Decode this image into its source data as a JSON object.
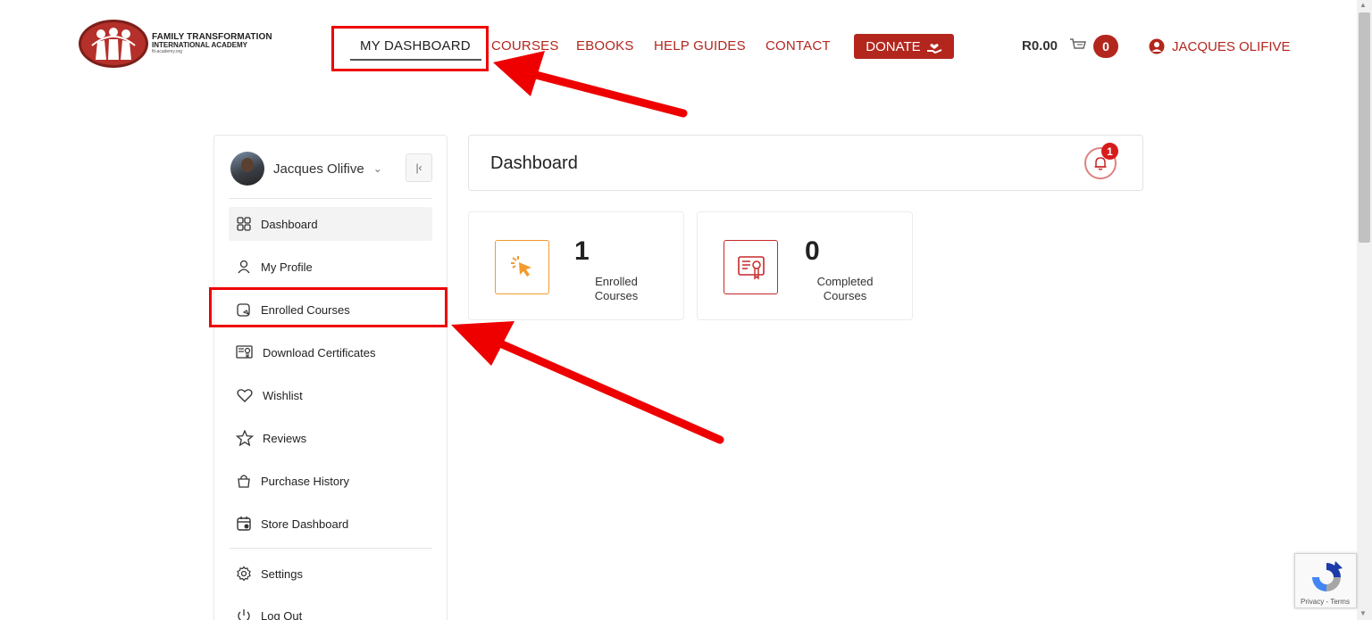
{
  "header": {
    "logo": {
      "line1": "FAMILY TRANSFORMATION",
      "line2": "INTERNATIONAL ACADEMY",
      "line3": "fti-academy.org"
    },
    "nav": [
      {
        "label": "MY DASHBOARD",
        "active": true
      },
      {
        "label": "COURSES"
      },
      {
        "label": "EBOOKS"
      },
      {
        "label": "HELP GUIDES"
      },
      {
        "label": "CONTACT"
      }
    ],
    "donate_label": "DONATE",
    "cart_amount": "R0.00",
    "cart_count": "0",
    "user_name": "JACQUES OLIFIVE"
  },
  "sidebar": {
    "profile_name": "Jacques Olifive",
    "items": [
      {
        "label": "Dashboard",
        "icon": "grid-icon",
        "active": true
      },
      {
        "label": "My Profile",
        "icon": "user-icon"
      },
      {
        "label": "Enrolled Courses",
        "icon": "book-icon"
      },
      {
        "label": "Download Certificates",
        "icon": "certificate-icon"
      },
      {
        "label": "Wishlist",
        "icon": "heart-icon"
      },
      {
        "label": "Reviews",
        "icon": "star-icon"
      },
      {
        "label": "Purchase History",
        "icon": "bag-icon"
      },
      {
        "label": "Store Dashboard",
        "icon": "calendar-icon"
      },
      {
        "label": "Settings",
        "icon": "gear-icon"
      },
      {
        "label": "Log Out",
        "icon": "power-icon"
      }
    ]
  },
  "main": {
    "title": "Dashboard",
    "notification_count": "1",
    "stats": [
      {
        "value": "1",
        "label_line1": "Enrolled",
        "label_line2": "Courses",
        "icon": "cursor-click-icon",
        "color": "#f29a2e"
      },
      {
        "value": "0",
        "label_line1": "Completed",
        "label_line2": "Courses",
        "icon": "certificate-icon",
        "color": "#c62828"
      }
    ]
  },
  "recaptcha": {
    "text": "Privacy - Terms"
  },
  "colors": {
    "brand_red": "#b3261e",
    "annotation_red": "#ee0000"
  }
}
